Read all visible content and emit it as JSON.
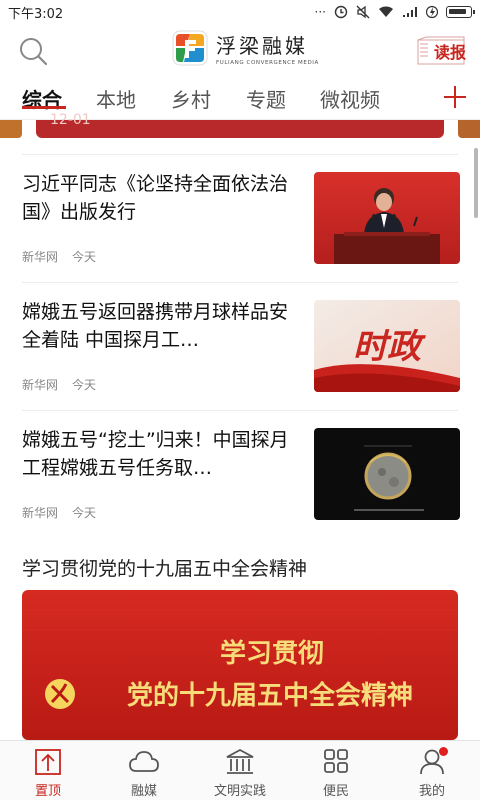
{
  "status_bar": {
    "time": "下午3:02",
    "icons": [
      "dots-icon",
      "alarm-icon",
      "mute-icon",
      "wifi-icon",
      "signal-icon",
      "charging-icon",
      "battery-icon"
    ]
  },
  "header": {
    "logo_name": "浮梁融媒",
    "logo_subtitle": "FULIANG CONVERGENCE MEDIA",
    "read_label": "读报"
  },
  "tabs": [
    {
      "label": "综合",
      "active": true
    },
    {
      "label": "本地",
      "active": false
    },
    {
      "label": "乡村",
      "active": false
    },
    {
      "label": "专题",
      "active": false
    },
    {
      "label": "微视频",
      "active": false
    }
  ],
  "banner": {
    "date_fragment": "12-01"
  },
  "news": [
    {
      "title": "习近平同志《论坚持全面依法治国》出版发行",
      "source": "新华网",
      "time": "今天",
      "thumb": "leader-speech-photo"
    },
    {
      "title": "嫦娥五号返回器携带月球样品安全着陆 中国探月工…",
      "source": "新华网",
      "time": "今天",
      "thumb": "shizheng-graphic",
      "thumb_text": "时政"
    },
    {
      "title": "嫦娥五号“挖土”归来！中国探月工程嫦娥五号任务取…",
      "source": "新华网",
      "time": "今天",
      "thumb": "lunar-probe-photo"
    }
  ],
  "section": {
    "title": "学习贯彻党的十九届五中全会精神",
    "banner_line1": "学习贯彻",
    "banner_line2": "党的十九届五中全会精神"
  },
  "bottom_nav": [
    {
      "label": "置顶",
      "icon": "top-arrow-icon",
      "active": true
    },
    {
      "label": "融媒",
      "icon": "cloud-icon",
      "active": false
    },
    {
      "label": "文明实践",
      "icon": "building-icon",
      "active": false
    },
    {
      "label": "便民",
      "icon": "grid-icon",
      "active": false
    },
    {
      "label": "我的",
      "icon": "user-icon",
      "active": false,
      "badge": true
    }
  ],
  "colors": {
    "accent": "#c8261f",
    "text": "#111111",
    "meta": "#888888"
  }
}
